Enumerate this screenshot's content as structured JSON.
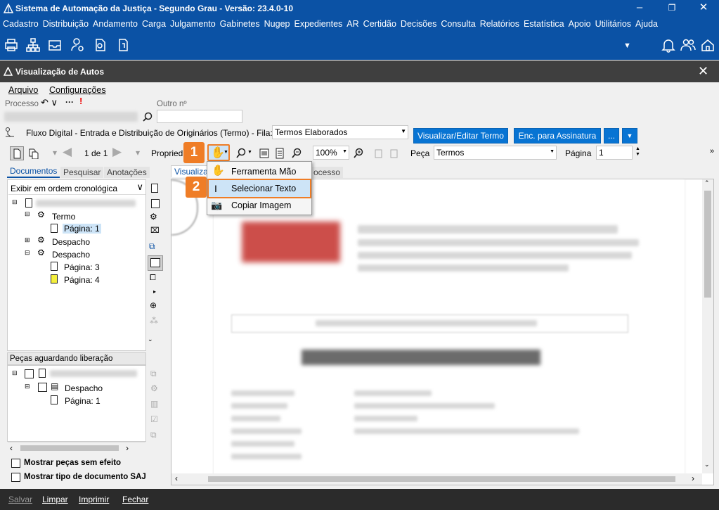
{
  "app": {
    "title": "Sistema de Automação da Justiça - Segundo Grau - Versão: 23.4.0-10"
  },
  "menu": [
    "Cadastro",
    "Distribuição",
    "Andamento",
    "Carga",
    "Julgamento",
    "Gabinetes",
    "Nugep",
    "Expedientes",
    "AR",
    "Certidão",
    "Decisões",
    "Consulta",
    "Relatórios",
    "Estatística",
    "Apoio",
    "Utilitários",
    "Ajuda"
  ],
  "window": {
    "title": "Visualização de Autos"
  },
  "submenu": {
    "arquivo": "Arquivo",
    "config": "Configurações"
  },
  "fields": {
    "processo_label": "Processo",
    "outro_label": "Outro nº",
    "queue_text": "Fluxo Digital - Entrada e Distribuição de Originários (Termo) - Fila:",
    "queue_value": "Termos Elaborados"
  },
  "buttons": {
    "visualizar": "Visualizar/Editar Termo",
    "enc": "Enc. para Assinatura",
    "more": "..."
  },
  "toolbar": {
    "page_of": "1 de 1",
    "propried": "Propried",
    "zoom": "100%",
    "peca_label": "Peça",
    "peca_value": "Termos",
    "pagina_label": "Página",
    "pagina_value": "1"
  },
  "tabs": {
    "documentos": "Documentos",
    "pesquisar": "Pesquisar",
    "anotacoes": "Anotações",
    "visualizacao": "Visualizaç",
    "processo": "ocesso"
  },
  "order": "Exibir em ordem cronológica",
  "tree": {
    "termo": "Termo",
    "pagina1": "Página: 1",
    "despacho1": "Despacho",
    "despacho2": "Despacho",
    "pagina3": "Página: 3",
    "pagina4": "Página: 4"
  },
  "pending": {
    "title": "Peças aguardando liberação",
    "despacho": "Despacho",
    "pagina": "Página: 1"
  },
  "checks": {
    "sem_efeito": "Mostrar peças sem efeito",
    "tipo_doc": "Mostrar tipo de documento SAJ"
  },
  "bottom": {
    "salvar": "Salvar",
    "limpar": "Limpar",
    "imprimir": "Imprimir",
    "fechar": "Fechar"
  },
  "context_menu": {
    "item1": "Ferramenta Mão",
    "item2": "Selecionar Texto",
    "item3": "Copiar Imagem"
  },
  "badges": {
    "b1": "1",
    "b2": "2"
  },
  "colors": {
    "accent": "#0b52a5",
    "badge": "#ef7d26",
    "dark": "#3f3f3f"
  }
}
